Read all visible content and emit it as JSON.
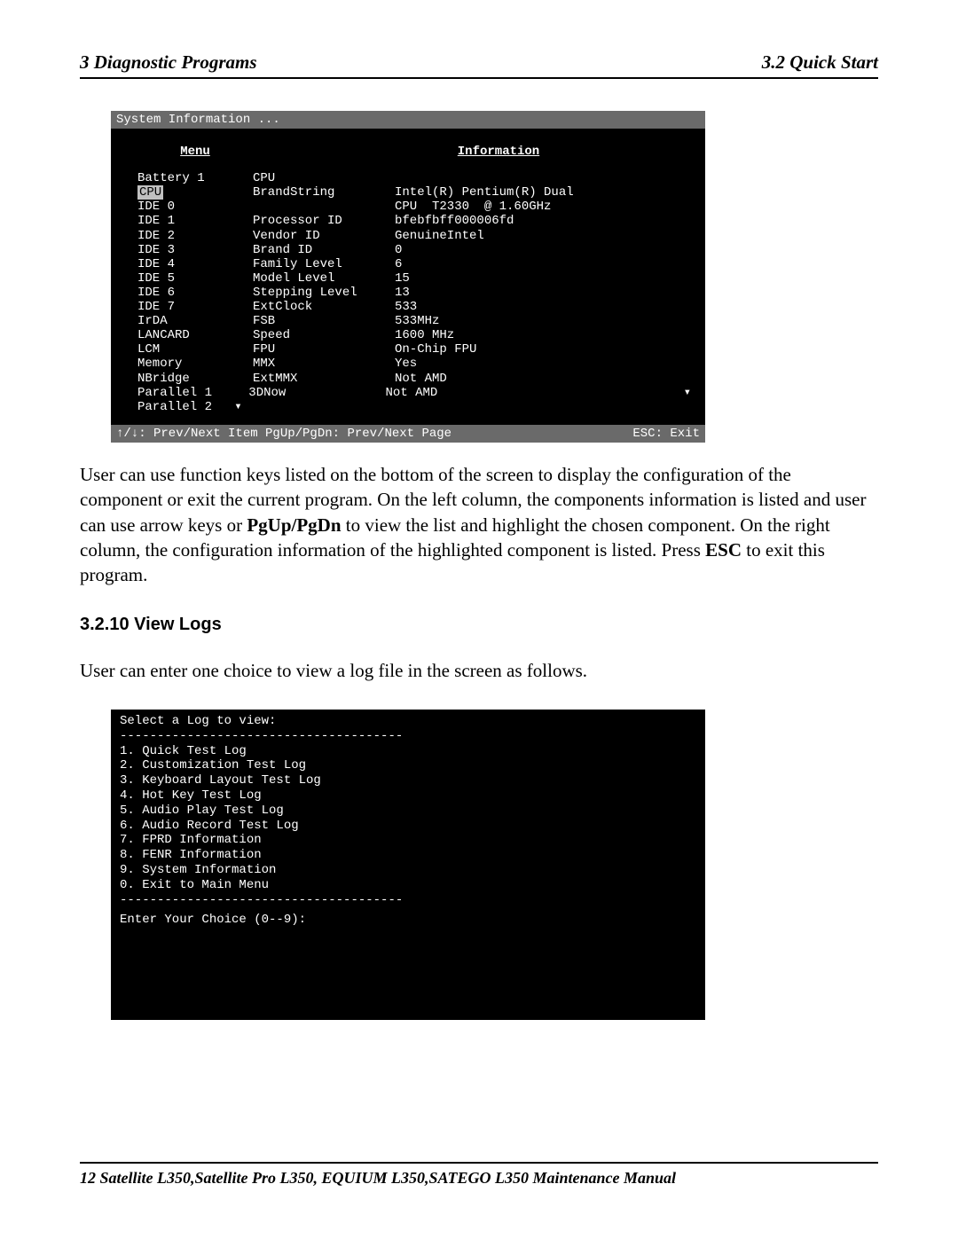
{
  "header": {
    "left": "3  Diagnostic Programs",
    "right": "3.2 Quick Start"
  },
  "term1": {
    "title": "System Information ...",
    "menu_header": "Menu",
    "info_header": "Information",
    "menu_items": [
      "Battery 1",
      "CPU",
      "IDE 0",
      "IDE 1",
      "IDE 2",
      "IDE 3",
      "IDE 4",
      "IDE 5",
      "IDE 6",
      "IDE 7",
      "IrDA",
      "LANCARD",
      "LCM",
      "Memory",
      "NBridge",
      "Parallel 1",
      "Parallel 2"
    ],
    "highlight_index": 1,
    "info_rows": [
      {
        "k": "CPU",
        "v": ""
      },
      {
        "k": "BrandString",
        "v": "Intel(R) Pentium(R) Dual"
      },
      {
        "k": "",
        "v": "CPU  T2330  @ 1.60GHz"
      },
      {
        "k": "Processor ID",
        "v": "bfebfbff000006fd"
      },
      {
        "k": "Vendor ID",
        "v": "GenuineIntel"
      },
      {
        "k": "Brand ID",
        "v": "0"
      },
      {
        "k": "Family Level",
        "v": "6"
      },
      {
        "k": "Model Level",
        "v": "15"
      },
      {
        "k": "Stepping Level",
        "v": "13"
      },
      {
        "k": "ExtClock",
        "v": "533"
      },
      {
        "k": "FSB",
        "v": "533MHz"
      },
      {
        "k": "Speed",
        "v": "1600 MHz"
      },
      {
        "k": "FPU",
        "v": "On-Chip FPU"
      },
      {
        "k": "MMX",
        "v": "Yes"
      },
      {
        "k": "ExtMMX",
        "v": "Not AMD"
      },
      {
        "k": "3DNow",
        "v": "Not AMD"
      }
    ],
    "footer_left": "↑/↓: Prev/Next Item PgUp/PgDn: Prev/Next Page",
    "footer_right": "ESC: Exit"
  },
  "para1_a": "User can use function keys listed on the bottom of the screen to display the configuration of the component or exit the current program. On the left column, the components information is listed and user can use arrow keys or ",
  "para1_b": "PgUp/PgDn",
  "para1_c": " to view the list and highlight the chosen component. On the right column, the configuration information of the highlighted component is listed. Press ",
  "para1_d": "ESC",
  "para1_e": " to exit this program.",
  "section_heading": "3.2.10 View Logs",
  "para2": "User can enter one choice to view a log file in the screen as follows.",
  "term2": {
    "header": "Select a Log to view:",
    "divider": "--------------------------------------",
    "items": [
      "1. Quick Test Log",
      "2. Customization Test Log",
      "3. Keyboard Layout Test Log",
      "4. Hot Key Test Log",
      "5. Audio Play Test Log",
      "6. Audio Record Test Log",
      "7. FPRD Information",
      "8. FENR Information",
      "9. System Information",
      "0. Exit to Main Menu"
    ],
    "prompt": "Enter Your Choice (0--9):"
  },
  "footer": {
    "page": "12",
    "title": "Satellite L350,Satellite Pro L350, EQUIUM L350,SATEGO L350 Maintenance Manual"
  }
}
